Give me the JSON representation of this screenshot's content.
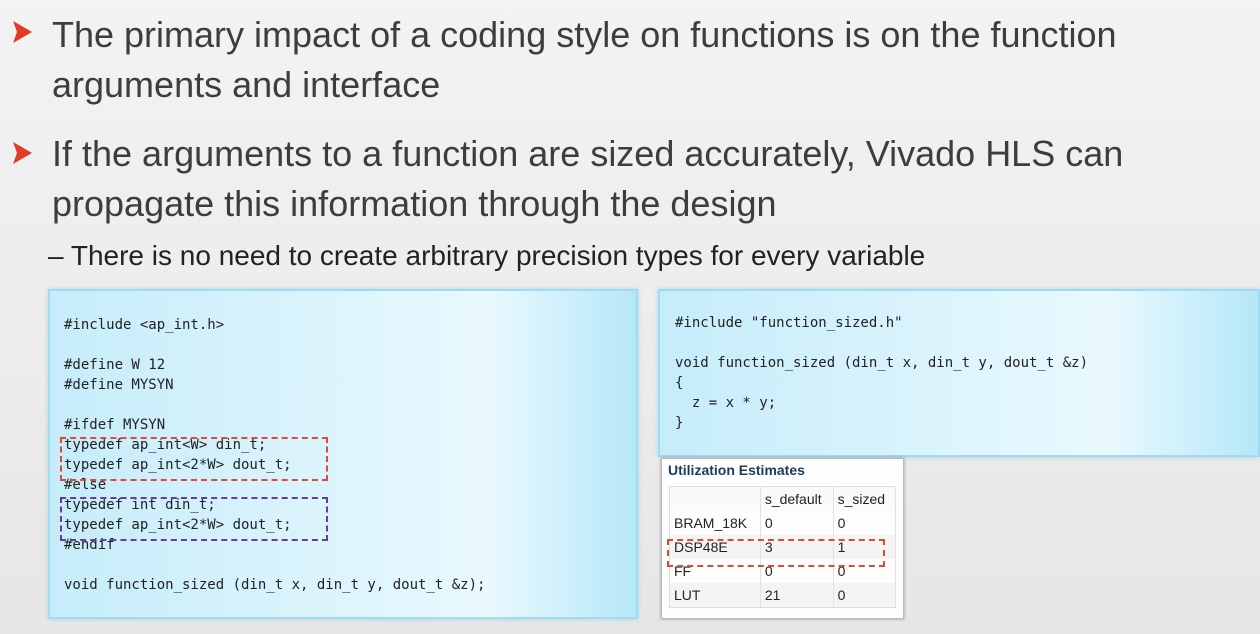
{
  "bullets": [
    {
      "line1": "The primary impact of a coding style on functions is on the function",
      "line2": "arguments and interface"
    },
    {
      "line1": "If the arguments to a function are sized accurately, Vivado HLS can",
      "line2": "propagate this information through the design"
    }
  ],
  "sub_bullet": "– There is no need to create arbitrary precision types for every variable",
  "accent_color": "#e03b24",
  "code_left": [
    "#include <ap_int.h>",
    "",
    "#define W 12",
    "#define MYSYN",
    "",
    "#ifdef MYSYN",
    "typedef ap_int<W> din_t;",
    "typedef ap_int<2*W> dout_t;",
    "#else",
    "typedef int din_t;",
    "typedef ap_int<2*W> dout_t;",
    "#endif",
    "",
    "void function_sized (din_t x, din_t y, dout_t &z);"
  ],
  "code_right": [
    "#include \"function_sized.h\"",
    "",
    "void function_sized (din_t x, din_t y, dout_t &z)",
    "{",
    "  z = x * y;",
    "}"
  ],
  "utilization": {
    "title": "Utilization Estimates",
    "columns": [
      "",
      "s_default",
      "s_sized"
    ],
    "rows": [
      [
        "BRAM_18K",
        "0",
        "0"
      ],
      [
        "DSP48E",
        "3",
        "1"
      ],
      [
        "FF",
        "0",
        "0"
      ],
      [
        "LUT",
        "21",
        "0"
      ]
    ]
  }
}
